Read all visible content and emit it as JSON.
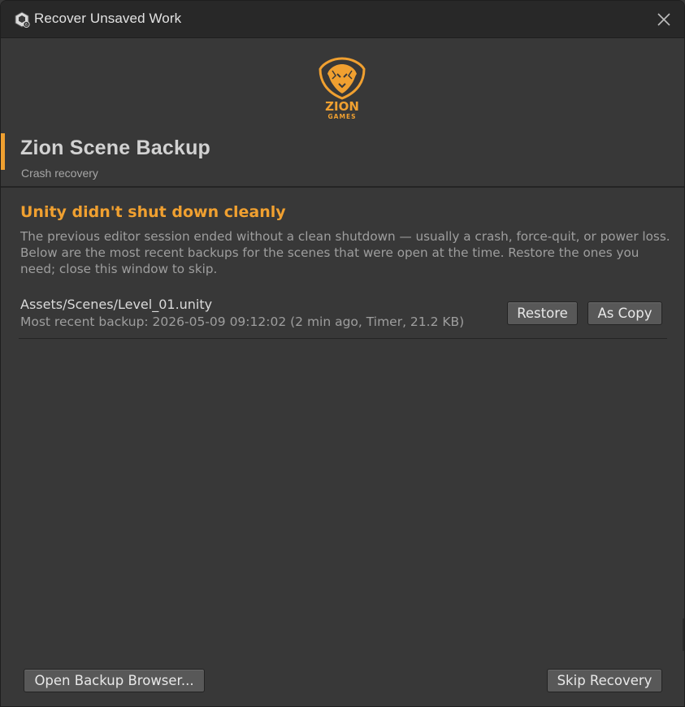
{
  "window": {
    "title": "Recover Unsaved Work",
    "app_icon": "unity-icon",
    "close_icon": "close-icon"
  },
  "brand": {
    "logo_icon": "lion-logo-icon",
    "logo_line1": "ZION",
    "logo_line2": "GAMES",
    "accent_color": "#f0a030"
  },
  "header": {
    "title": "Zion Scene Backup",
    "subtitle": "Crash recovery"
  },
  "warning": {
    "title": "Unity didn't shut down cleanly",
    "body": "The previous editor session ended without a clean shutdown — usually a crash, force-quit, or power loss. Below are the most recent backups for the scenes that were open at the time. Restore the ones you need; close this window to skip."
  },
  "backups": [
    {
      "path": "Assets/Scenes/Level_01.unity",
      "info": "Most recent backup: 2026-05-09 09:12:02 (2 min ago, Timer, 21.2 KB)",
      "restore_label": "Restore",
      "copy_label": "As Copy"
    }
  ],
  "footer": {
    "browser_label": "Open Backup Browser...",
    "skip_label": "Skip Recovery"
  }
}
